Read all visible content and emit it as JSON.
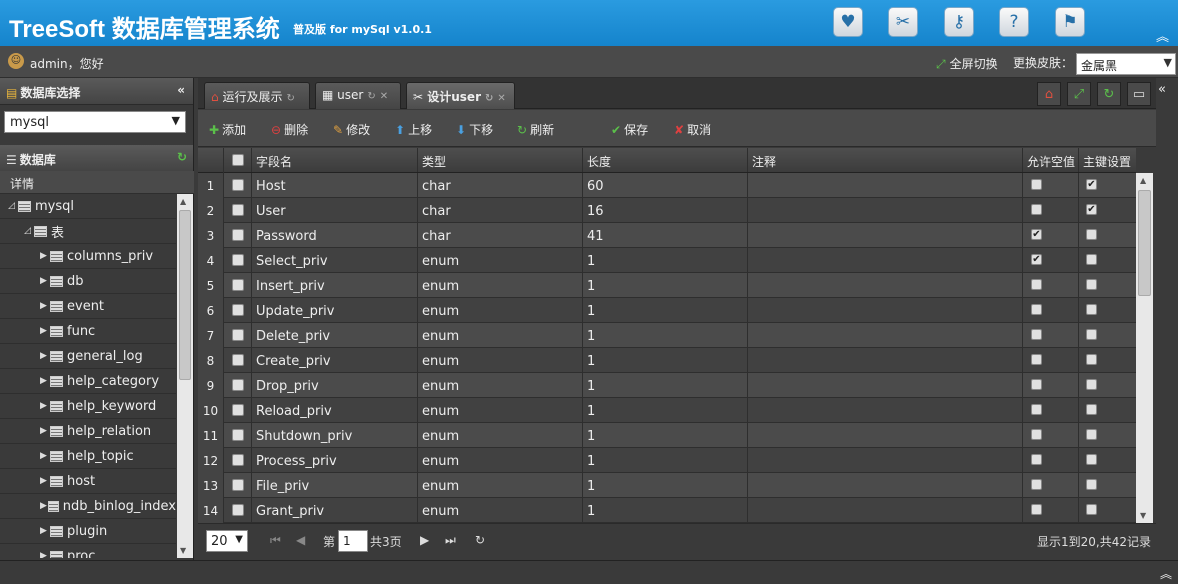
{
  "header": {
    "title": "TreeSoft 数据库管理系统",
    "subtitle": "普及版 for mySql v1.0.1",
    "icons": [
      "heart-icon",
      "tools-icon",
      "key-icon",
      "help-icon",
      "user-run-icon"
    ]
  },
  "userbar": {
    "greeting": "admin，您好",
    "fullscreen_label": "全屏切换",
    "skin_label": "更换皮肤：",
    "skin_value": "金属黑"
  },
  "left": {
    "db_select_title": "数据库选择",
    "db_select_value": "mysql",
    "db_panel_title": "数据库",
    "detail_label": "详情",
    "tree_root": "mysql",
    "tree_group": "表",
    "tables": [
      "columns_priv",
      "db",
      "event",
      "func",
      "general_log",
      "help_category",
      "help_keyword",
      "help_relation",
      "help_topic",
      "host",
      "ndb_binlog_index",
      "plugin",
      "proc"
    ]
  },
  "tabs": [
    {
      "label": "运行及展示",
      "icon": "home-icon"
    },
    {
      "label": "user",
      "icon": "table-icon"
    },
    {
      "label": "设计user",
      "icon": "tools-icon"
    }
  ],
  "toolbar": {
    "add": "添加",
    "delete": "删除",
    "edit": "修改",
    "up": "上移",
    "down": "下移",
    "refresh": "刷新",
    "save": "保存",
    "cancel": "取消"
  },
  "grid": {
    "headers": {
      "field": "字段名",
      "type": "类型",
      "length": "长度",
      "comment": "注释",
      "nullable": "允许空值",
      "pk": "主键设置"
    },
    "rows": [
      {
        "n": "1",
        "field": "Host",
        "type": "char",
        "length": "60",
        "nullable": false,
        "pk": true
      },
      {
        "n": "2",
        "field": "User",
        "type": "char",
        "length": "16",
        "nullable": false,
        "pk": true
      },
      {
        "n": "3",
        "field": "Password",
        "type": "char",
        "length": "41",
        "nullable": true,
        "pk": false
      },
      {
        "n": "4",
        "field": "Select_priv",
        "type": "enum",
        "length": "1",
        "nullable": true,
        "pk": false
      },
      {
        "n": "5",
        "field": "Insert_priv",
        "type": "enum",
        "length": "1",
        "nullable": false,
        "pk": false
      },
      {
        "n": "6",
        "field": "Update_priv",
        "type": "enum",
        "length": "1",
        "nullable": false,
        "pk": false
      },
      {
        "n": "7",
        "field": "Delete_priv",
        "type": "enum",
        "length": "1",
        "nullable": false,
        "pk": false
      },
      {
        "n": "8",
        "field": "Create_priv",
        "type": "enum",
        "length": "1",
        "nullable": false,
        "pk": false
      },
      {
        "n": "9",
        "field": "Drop_priv",
        "type": "enum",
        "length": "1",
        "nullable": false,
        "pk": false
      },
      {
        "n": "10",
        "field": "Reload_priv",
        "type": "enum",
        "length": "1",
        "nullable": false,
        "pk": false
      },
      {
        "n": "11",
        "field": "Shutdown_priv",
        "type": "enum",
        "length": "1",
        "nullable": false,
        "pk": false
      },
      {
        "n": "12",
        "field": "Process_priv",
        "type": "enum",
        "length": "1",
        "nullable": false,
        "pk": false
      },
      {
        "n": "13",
        "field": "File_priv",
        "type": "enum",
        "length": "1",
        "nullable": false,
        "pk": false
      },
      {
        "n": "14",
        "field": "Grant_priv",
        "type": "enum",
        "length": "1",
        "nullable": false,
        "pk": false
      }
    ]
  },
  "pager": {
    "page_size": "20",
    "page_prefix": "第",
    "page": "1",
    "page_suffix": "共3页",
    "summary": "显示1到20,共42记录"
  }
}
